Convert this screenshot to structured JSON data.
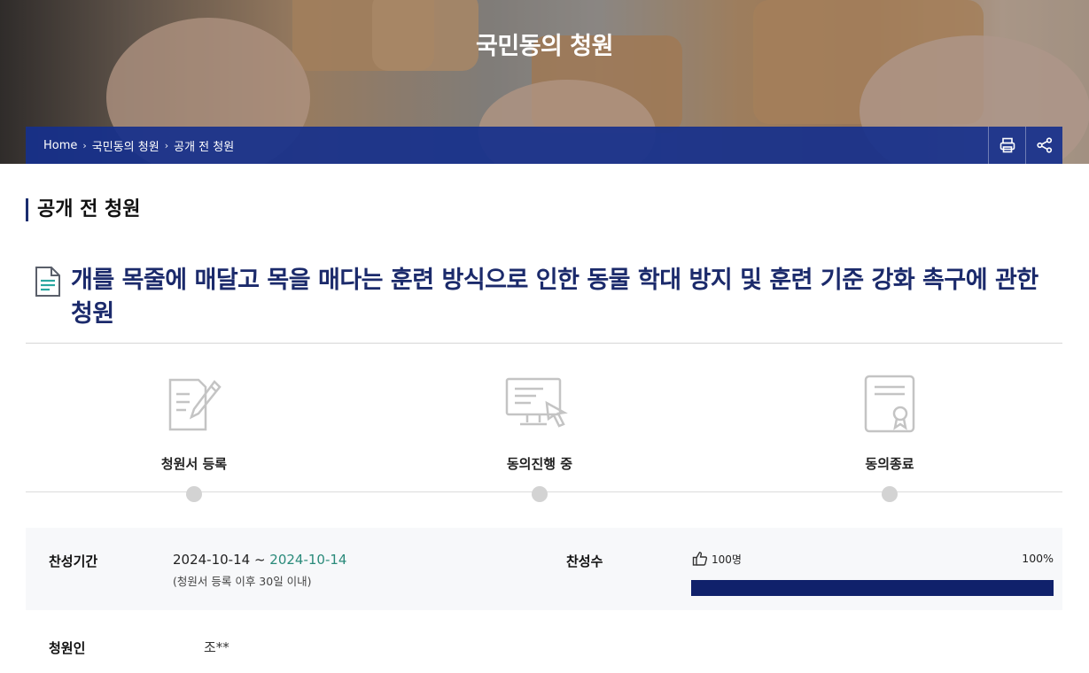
{
  "hero": {
    "title": "국민동의 청원"
  },
  "breadcrumb": {
    "items": [
      "Home",
      "국민동의 청원",
      "공개 전 청원"
    ],
    "separator": "›"
  },
  "toolbar": {
    "print_icon": "printer-icon",
    "share_icon": "share-icon"
  },
  "section": {
    "title": "공개 전 청원"
  },
  "petition": {
    "title": "개를 목줄에 매달고 목을 매다는 훈련 방식으로 인한 동물 학대 방지 및 훈련 기준 강화 촉구에 관한 청원",
    "icon": "document-icon"
  },
  "steps": [
    {
      "label": "청원서 등록",
      "icon": "pen-document-icon"
    },
    {
      "label": "동의진행 중",
      "icon": "computer-click-icon"
    },
    {
      "label": "동의종료",
      "icon": "certificate-icon"
    }
  ],
  "info": {
    "period_label": "찬성기간",
    "period_start": "2024-10-14",
    "period_sep": " ~ ",
    "period_end": "2024-10-14",
    "period_note": "(청원서 등록 이후 30일 이내)",
    "count_label": "찬성수",
    "count_value": "100명",
    "count_icon": "thumbs-up-icon",
    "percent_label": "100%",
    "progress": 1.0,
    "petitioner_label": "청원인",
    "petitioner_value": "조**"
  },
  "colors": {
    "accent": "#1b2a6b",
    "bar": "#16308c",
    "progress": "#10216b",
    "date_end": "#2a8a7a"
  }
}
